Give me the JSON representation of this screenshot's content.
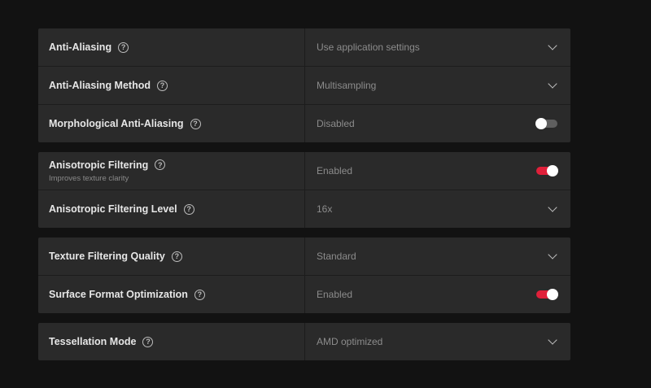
{
  "groups": [
    {
      "rows": [
        {
          "label": "Anti-Aliasing",
          "value": "Use application settings",
          "control": "dropdown"
        },
        {
          "label": "Anti-Aliasing Method",
          "value": "Multisampling",
          "control": "dropdown"
        },
        {
          "label": "Morphological Anti-Aliasing",
          "value": "Disabled",
          "control": "toggle",
          "state": "off"
        }
      ]
    },
    {
      "rows": [
        {
          "label": "Anisotropic Filtering",
          "sublabel": "Improves texture clarity",
          "value": "Enabled",
          "control": "toggle",
          "state": "on"
        },
        {
          "label": "Anisotropic Filtering Level",
          "value": "16x",
          "control": "dropdown"
        }
      ]
    },
    {
      "rows": [
        {
          "label": "Texture Filtering Quality",
          "value": "Standard",
          "control": "dropdown"
        },
        {
          "label": "Surface Format Optimization",
          "value": "Enabled",
          "control": "toggle",
          "state": "on"
        }
      ]
    },
    {
      "rows": [
        {
          "label": "Tessellation Mode",
          "value": "AMD optimized",
          "control": "dropdown"
        }
      ]
    }
  ],
  "icons": {
    "help": "question-circle-icon",
    "dropdown": "chevron-down-icon"
  },
  "help_glyph": "?",
  "colors": {
    "accent": "#e0203a",
    "panel": "#2a2a2a",
    "background": "#121212",
    "toggle_off": "#5f5f5f"
  }
}
